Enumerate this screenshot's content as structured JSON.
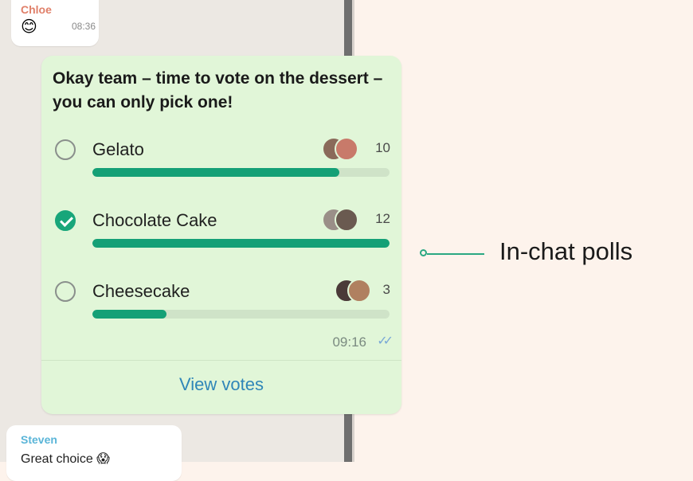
{
  "chat": {
    "messages": [
      {
        "sender": "Chloe",
        "text": "😊",
        "time": "08:36"
      },
      {
        "sender": "Steven",
        "text": "Great choice 😱"
      }
    ]
  },
  "poll": {
    "question": "Okay team – time to vote on the dessert – you can only pick one!",
    "options": [
      {
        "label": "Gelato",
        "votes": "10",
        "checked": false,
        "progress_fraction": 0.83
      },
      {
        "label": "Chocolate Cake",
        "votes": "12",
        "checked": true,
        "progress_fraction": 1.0
      },
      {
        "label": "Cheesecake",
        "votes": "3",
        "checked": false,
        "progress_fraction": 0.25
      }
    ],
    "time": "09:16",
    "view_votes_label": "View votes"
  },
  "feature_label": "In-chat polls",
  "colors": {
    "accent_green": "#14a076",
    "poll_bubble": "#e1f6d8",
    "link_blue": "#2f86b8",
    "background": "#fdf3ec"
  },
  "icons": {
    "radio_unchecked": "radio-unchecked-icon",
    "radio_checked": "radio-checked-icon",
    "read_receipt": "double-check-icon"
  }
}
